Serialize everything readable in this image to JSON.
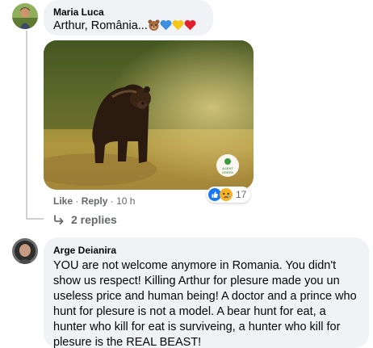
{
  "comment1": {
    "author": "Maria Luca",
    "text": "Arthur, România...",
    "emojis": [
      "bear-emoji",
      "blue-heart",
      "yellow-heart",
      "red-heart"
    ],
    "image_alt": "Brown bear standing in a grassy field",
    "watermark": "AGENT GREEN",
    "actions": {
      "like": "Like",
      "reply": "Reply",
      "sep": "·",
      "time": "10 h"
    },
    "reactions": {
      "types": [
        "like",
        "sad"
      ],
      "count": "17"
    },
    "replies_label": "2 replies"
  },
  "comment2": {
    "author": "Arge Deianira",
    "text": "YOU are not welcome anymore in Romania. You didn't show us respect! Killing Arthur for plesure made you un useless price and human being! A doctor and a prince who hunt for plesure is not a model. A bear hunt for eat, a hunter who kill for eat is surviveing, a hunter who kill for plesure is the REAL BEAST!"
  },
  "colors": {
    "bubble": "#f0f2f5",
    "meta": "#65676b",
    "like_blue": "#1877f2",
    "sad_yellow": "#f7b125"
  }
}
